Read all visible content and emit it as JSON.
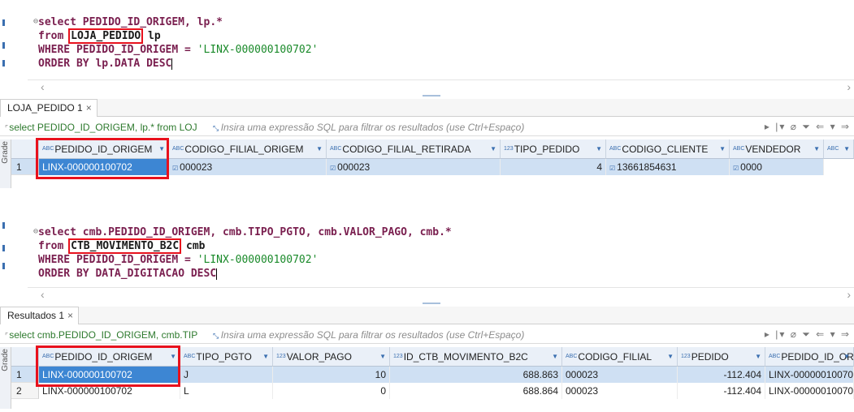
{
  "panel1": {
    "sql": {
      "line1": "select PEDIDO_ID_ORIGEM, lp.*",
      "line2_kw": "from",
      "line2_table": "LOJA_PEDIDO",
      "line2_alias": " lp",
      "line3_kw": "WHERE",
      "line3_rest": " PEDIDO_ID_ORIGEM = ",
      "line3_str": "'LINX-000000100702'",
      "line4_kw": "ORDER BY",
      "line4_rest": " lp.DATA ",
      "line4_kw2": "DESC"
    },
    "tab": {
      "label": "LOJA_PEDIDO 1",
      "close": "×"
    },
    "filter": {
      "query": "select PEDIDO_ID_ORIGEM, lp.* from LOJ",
      "hint": "Insira uma expressão SQL para filtrar os resultados (use Ctrl+Espaço)"
    },
    "side_label": "Grade",
    "columns": [
      {
        "type": "ABC",
        "name": "PEDIDO_ID_ORIGEM"
      },
      {
        "type": "ABC",
        "name": "CODIGO_FILIAL_ORIGEM"
      },
      {
        "type": "ABC",
        "name": "CODIGO_FILIAL_RETIRADA"
      },
      {
        "type": "123",
        "name": "TIPO_PEDIDO"
      },
      {
        "type": "ABC",
        "name": "CODIGO_CLIENTE"
      },
      {
        "type": "ABC",
        "name": "VENDEDOR"
      },
      {
        "type": "ABC",
        "name": ""
      }
    ],
    "rows": [
      {
        "n": "1",
        "cells": [
          "LINX-000000100702",
          "000023",
          "000023",
          "4",
          "13661854631",
          "0000"
        ]
      }
    ]
  },
  "panel2": {
    "sql": {
      "line1": "select cmb.PEDIDO_ID_ORIGEM, cmb.TIPO_PGTO, cmb.VALOR_PAGO, cmb.*",
      "line2_kw": "from",
      "line2_table": "CTB_MOVIMENTO_B2C",
      "line2_alias": " cmb",
      "line3_kw": "WHERE",
      "line3_rest": " PEDIDO_ID_ORIGEM = ",
      "line3_str": "'LINX-000000100702'",
      "line4_kw": "ORDER BY",
      "line4_rest": " DATA_DIGITACAO ",
      "line4_kw2": "DESC"
    },
    "tab": {
      "label": "Resultados 1",
      "close": "×"
    },
    "filter": {
      "query": "select cmb.PEDIDO_ID_ORIGEM, cmb.TIP",
      "hint": "Insira uma expressão SQL para filtrar os resultados (use Ctrl+Espaço)"
    },
    "side_label": "Grade",
    "columns": [
      {
        "type": "ABC",
        "name": "PEDIDO_ID_ORIGEM"
      },
      {
        "type": "ABC",
        "name": "TIPO_PGTO"
      },
      {
        "type": "123",
        "name": "VALOR_PAGO"
      },
      {
        "type": "123",
        "name": "ID_CTB_MOVIMENTO_B2C"
      },
      {
        "type": "ABC",
        "name": "CODIGO_FILIAL"
      },
      {
        "type": "123",
        "name": "PEDIDO"
      },
      {
        "type": "ABC",
        "name": "PEDIDO_ID_ORI"
      }
    ],
    "rows": [
      {
        "n": "1",
        "cells": [
          "LINX-000000100702",
          "J",
          "10",
          "688.863",
          "000023",
          "-112.404",
          "LINX-00000010070"
        ]
      },
      {
        "n": "2",
        "cells": [
          "LINX-000000100702",
          "L",
          "0",
          "688.864",
          "000023",
          "-112.404",
          "LINX-00000010070"
        ]
      }
    ]
  },
  "colors": {
    "highlight": "#e8111d",
    "keyword": "#7a1f4f",
    "string": "#1a8a2a",
    "selection": "#3d86d3"
  }
}
